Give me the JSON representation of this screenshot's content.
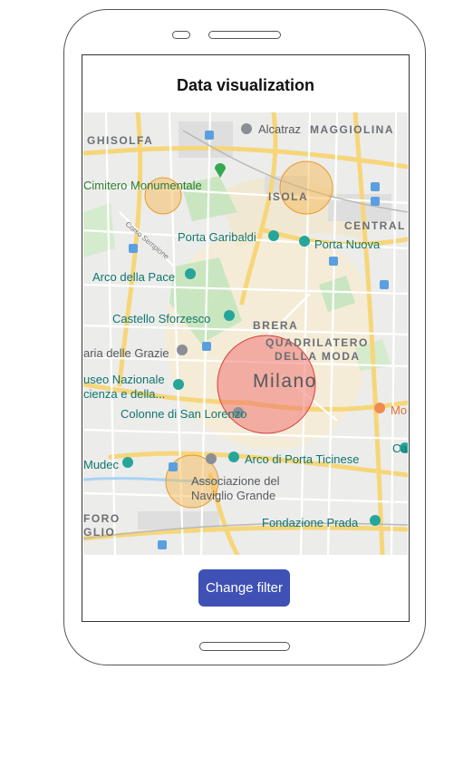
{
  "screen": {
    "title": "Data visualization",
    "button_label": "Change filter"
  },
  "map": {
    "city_label": "Milano",
    "places": [
      {
        "id": "alcatraz",
        "name": "Alcatraz",
        "kind": "poi"
      },
      {
        "id": "cimitero",
        "name": "Cimitero Monumentale",
        "kind": "park"
      },
      {
        "id": "garibaldi",
        "name": "Porta Garibaldi",
        "kind": "transit"
      },
      {
        "id": "nuova",
        "name": "Porta Nuova",
        "kind": "transit"
      },
      {
        "id": "pace",
        "name": "Arco della Pace",
        "kind": "poi"
      },
      {
        "id": "sforzesco",
        "name": "Castello Sforzesco",
        "kind": "poi"
      },
      {
        "id": "grazie",
        "name": "aria delle Grazie",
        "kind": "poi"
      },
      {
        "id": "museo1",
        "name": "useo Nazionale",
        "kind": "poi"
      },
      {
        "id": "museo2",
        "name": "cienza e della...",
        "kind": "poi"
      },
      {
        "id": "colonne",
        "name": "Colonne di San Lorenzo",
        "kind": "poi"
      },
      {
        "id": "mudec",
        "name": "Mudec",
        "kind": "poi"
      },
      {
        "id": "ticinese",
        "name": "Arco di Porta Ticinese",
        "kind": "poi"
      },
      {
        "id": "naviglio1",
        "name": "Associazione del",
        "kind": "poi"
      },
      {
        "id": "naviglio2",
        "name": "Naviglio Grande",
        "kind": "poi"
      },
      {
        "id": "prada",
        "name": "Fondazione Prada",
        "kind": "poi"
      },
      {
        "id": "mo",
        "name": "Mo",
        "kind": "food"
      },
      {
        "id": "ca",
        "name": "Ca",
        "kind": "poi"
      }
    ],
    "districts": [
      {
        "id": "ghisolfa",
        "name": "GHISOLFA"
      },
      {
        "id": "maggiolina",
        "name": "MAGGIOLINA"
      },
      {
        "id": "isola",
        "name": "ISOLA"
      },
      {
        "id": "centrale",
        "name": "CENTRAL"
      },
      {
        "id": "brera",
        "name": "BRERA"
      },
      {
        "id": "quad1",
        "name": "QUADRILATERO"
      },
      {
        "id": "quad2",
        "name": "DELLA MODA"
      },
      {
        "id": "foro",
        "name": "FORO"
      },
      {
        "id": "glio",
        "name": "GLIO"
      },
      {
        "id": "sempione",
        "name": "Corso Sempione"
      }
    ],
    "data_circles": [
      {
        "id": "c1",
        "level": "medium",
        "color": "#f5b041"
      },
      {
        "id": "c2",
        "level": "medium",
        "color": "#f5b041"
      },
      {
        "id": "c3",
        "level": "high",
        "color": "#ef5350"
      },
      {
        "id": "c4",
        "level": "medium",
        "color": "#f5b041"
      }
    ]
  }
}
